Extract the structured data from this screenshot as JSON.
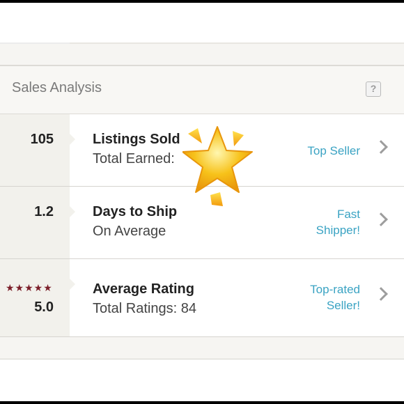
{
  "header": {
    "title": "Sales Analysis",
    "help_label": "?"
  },
  "rows": [
    {
      "value": "105",
      "main": "Listings Sold",
      "sub": "Total Earned: ",
      "badge": "Top Seller"
    },
    {
      "value": "1.2",
      "main": "Days to Ship",
      "sub": "On Average",
      "badge_line1": "Fast",
      "badge_line2": "Shipper!"
    },
    {
      "stars": "★★★★★",
      "value": "5.0",
      "main": "Average Rating",
      "sub": "Total Ratings: 84",
      "badge_line1": "Top-rated",
      "badge_line2": "Seller!"
    }
  ],
  "colors": {
    "accent": "#3aa3c3",
    "star": "#7c1f2a",
    "emoji_star": "#f7c21a"
  },
  "icons": {
    "help": "question-mark-icon",
    "chevron": "chevron-right-icon",
    "overlay": "glowing-star-emoji"
  }
}
